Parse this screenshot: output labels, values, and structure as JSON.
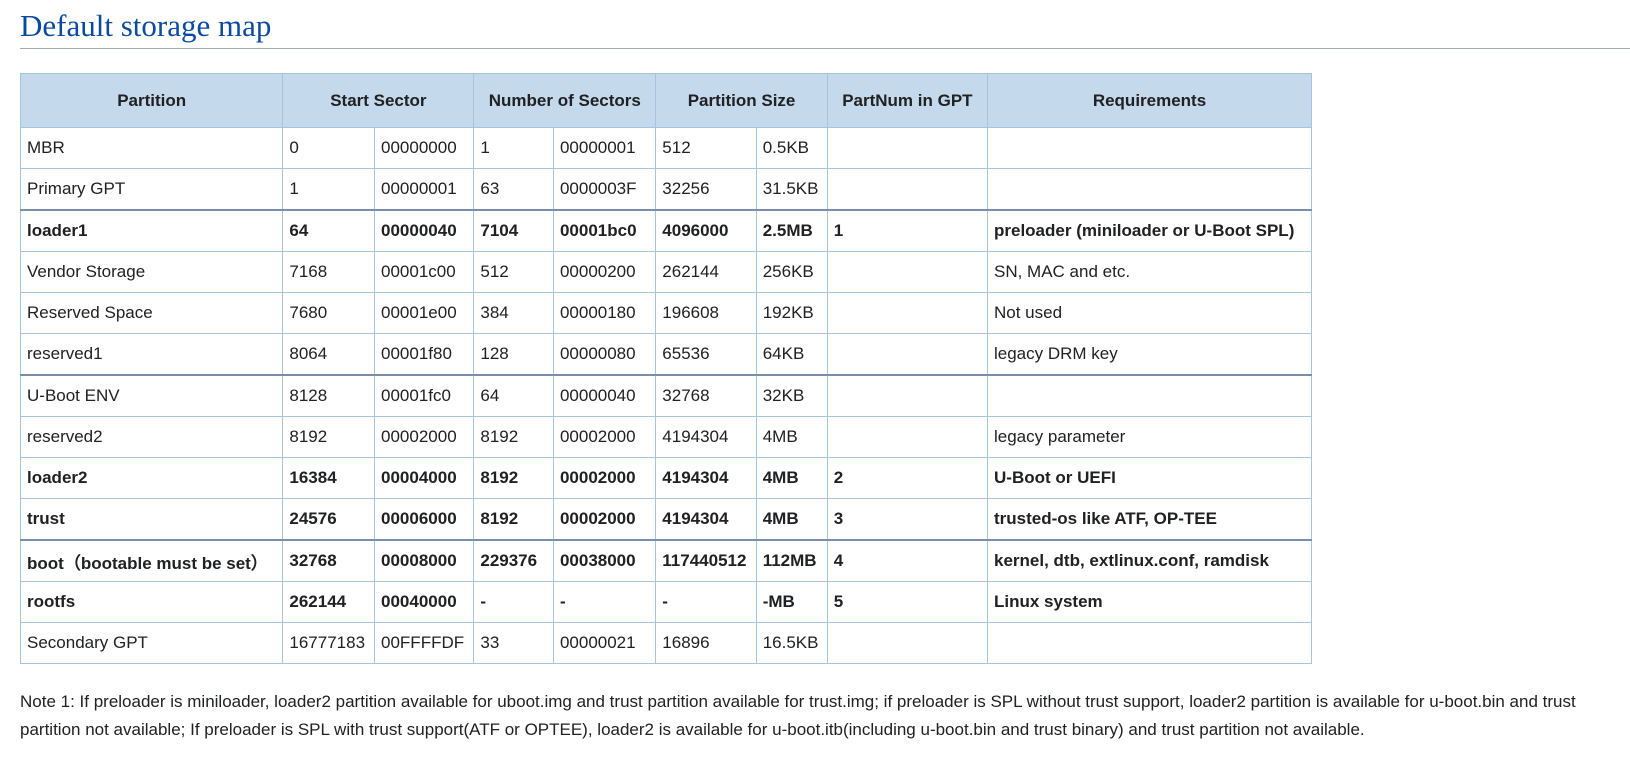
{
  "heading": "Default storage map",
  "table": {
    "headers": [
      "Partition",
      "Start Sector",
      "Number of Sectors",
      "Partition Size",
      "PartNum in GPT",
      "Requirements"
    ],
    "rows": [
      {
        "cells": [
          "MBR",
          "0",
          "00000000",
          "1",
          "00000001",
          "512",
          "0.5KB",
          "",
          ""
        ],
        "bold": false,
        "sep": false
      },
      {
        "cells": [
          "Primary GPT",
          "1",
          "00000001",
          "63",
          "0000003F",
          "32256",
          "31.5KB",
          "",
          ""
        ],
        "bold": false,
        "sep": false
      },
      {
        "cells": [
          "loader1",
          "64",
          "00000040",
          "7104",
          "00001bc0",
          "4096000",
          "2.5MB",
          "1",
          "preloader (miniloader or U-Boot SPL)"
        ],
        "bold": true,
        "sep": true
      },
      {
        "cells": [
          "Vendor Storage",
          "7168",
          "00001c00",
          "512",
          "00000200",
          "262144",
          "256KB",
          "",
          "SN, MAC and etc."
        ],
        "bold": false,
        "sep": false
      },
      {
        "cells": [
          "Reserved Space",
          "7680",
          "00001e00",
          "384",
          "00000180",
          "196608",
          "192KB",
          "",
          "Not used"
        ],
        "bold": false,
        "sep": false
      },
      {
        "cells": [
          "reserved1",
          "8064",
          "00001f80",
          "128",
          "00000080",
          "65536",
          "64KB",
          "",
          "legacy DRM key"
        ],
        "bold": false,
        "sep": false
      },
      {
        "cells": [
          "U-Boot ENV",
          "8128",
          "00001fc0",
          "64",
          "00000040",
          "32768",
          "32KB",
          "",
          ""
        ],
        "bold": false,
        "sep": true
      },
      {
        "cells": [
          "reserved2",
          "8192",
          "00002000",
          "8192",
          "00002000",
          "4194304",
          "4MB",
          "",
          "legacy parameter"
        ],
        "bold": false,
        "sep": false
      },
      {
        "cells": [
          "loader2",
          "16384",
          "00004000",
          "8192",
          "00002000",
          "4194304",
          "4MB",
          "2",
          "U-Boot or UEFI"
        ],
        "bold": true,
        "sep": false
      },
      {
        "cells": [
          "trust",
          "24576",
          "00006000",
          "8192",
          "00002000",
          "4194304",
          "4MB",
          "3",
          "trusted-os like ATF, OP-TEE"
        ],
        "bold": true,
        "sep": false
      },
      {
        "cells": [
          "boot（bootable must be set）",
          "32768",
          "00008000",
          "229376",
          "00038000",
          "117440512",
          "112MB",
          "4",
          "kernel, dtb, extlinux.conf, ramdisk"
        ],
        "bold": true,
        "sep": true
      },
      {
        "cells": [
          "rootfs",
          "262144",
          "00040000",
          "-",
          "-",
          "-",
          "-MB",
          "5",
          "Linux system"
        ],
        "bold": true,
        "sep": false
      },
      {
        "cells": [
          "Secondary GPT",
          "16777183",
          "00FFFFDF",
          "33",
          "00000021",
          "16896",
          "16.5KB",
          "",
          ""
        ],
        "bold": false,
        "sep": false
      }
    ]
  },
  "note": "Note 1: If preloader is miniloader, loader2 partition available for uboot.img and trust partition available for trust.img; if preloader is SPL without trust support, loader2 partition is available for u-boot.bin and trust partition not available; If preloader is SPL with trust support(ATF or OPTEE), loader2 is available for u-boot.itb(including u-boot.bin and trust binary) and trust partition not available."
}
